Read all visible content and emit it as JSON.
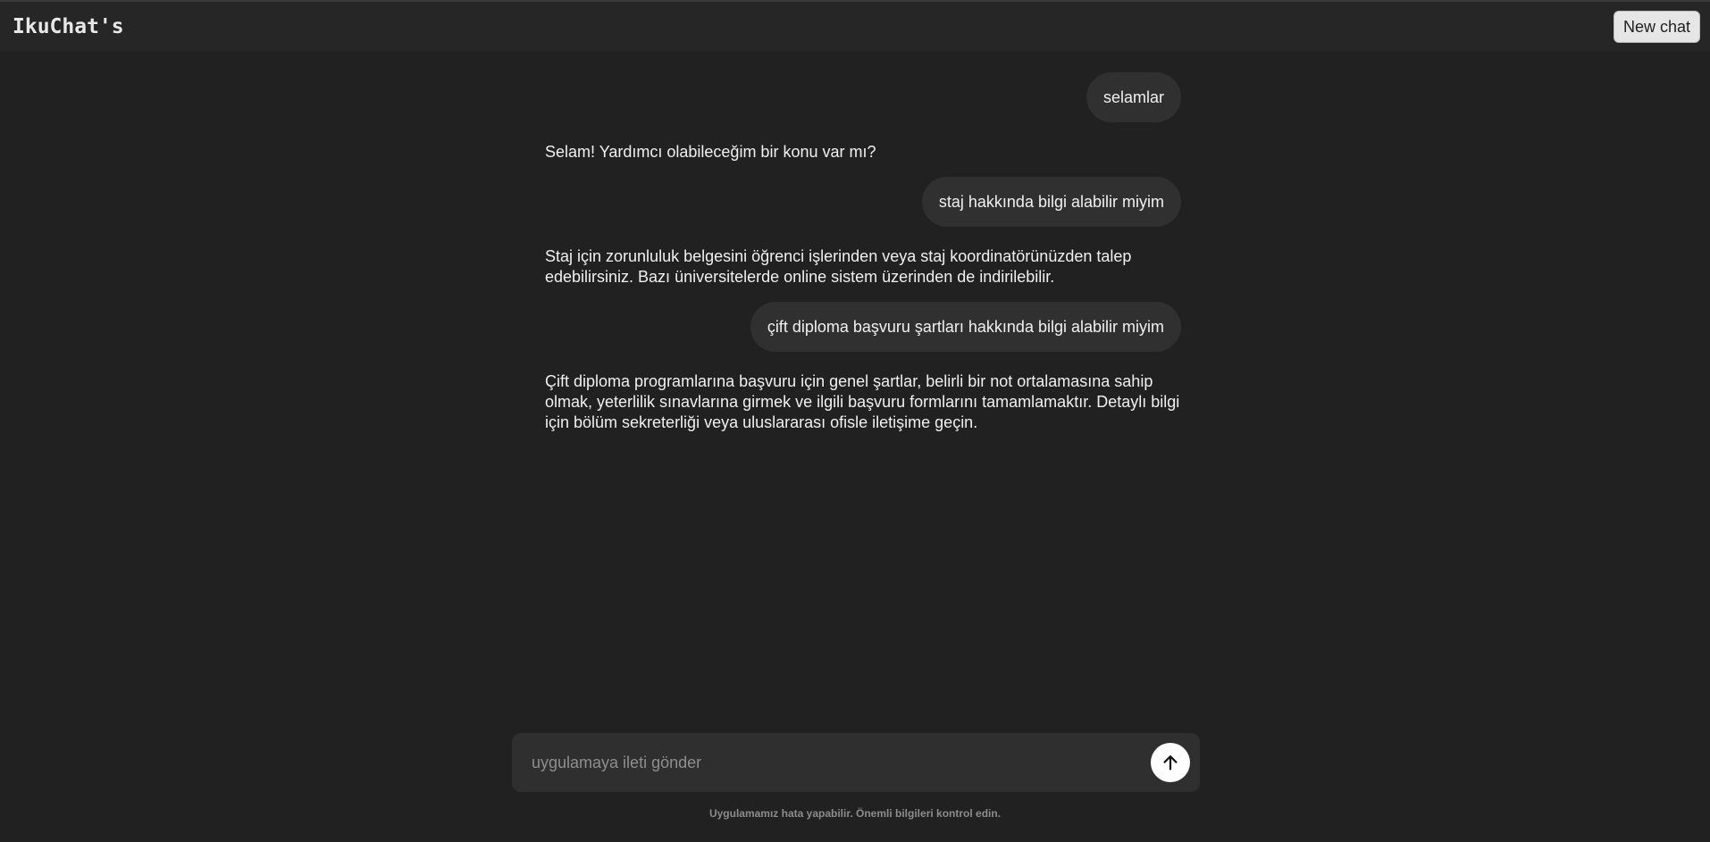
{
  "header": {
    "brand": "IkuChat's",
    "new_chat_label": "New chat"
  },
  "messages": [
    {
      "role": "user",
      "text": "selamlar"
    },
    {
      "role": "assistant",
      "text": "Selam! Yardımcı olabileceğim bir konu var mı?"
    },
    {
      "role": "user",
      "text": "staj hakkında bilgi alabilir miyim"
    },
    {
      "role": "assistant",
      "text": "Staj için zorunluluk belgesini öğrenci işlerinden veya staj koordinatörünüzden talep edebilirsiniz. Bazı üniversitelerde online sistem üzerinden de indirilebilir."
    },
    {
      "role": "user",
      "text": "çift diploma başvuru şartları hakkında bilgi alabilir miyim"
    },
    {
      "role": "assistant",
      "text": "Çift diploma programlarına başvuru için genel şartlar, belirli bir not ortalamasına sahip olmak, yeterlilik sınavlarına girmek ve ilgili başvuru formlarını tamamlamaktır. Detaylı bilgi için bölüm sekreterliği veya uluslararası ofisle iletişime geçin."
    }
  ],
  "composer": {
    "placeholder": "uygulamaya ileti gönder",
    "value": "",
    "send_icon": "arrow-up-icon"
  },
  "footer": {
    "disclaimer": "Uygulamamız hata yapabilir. Önemli bilgileri kontrol edin."
  },
  "colors": {
    "background": "#212121",
    "header": "#262626",
    "bubble": "#303030",
    "composer": "#2f2f2f",
    "send_button": "#ffffff"
  }
}
